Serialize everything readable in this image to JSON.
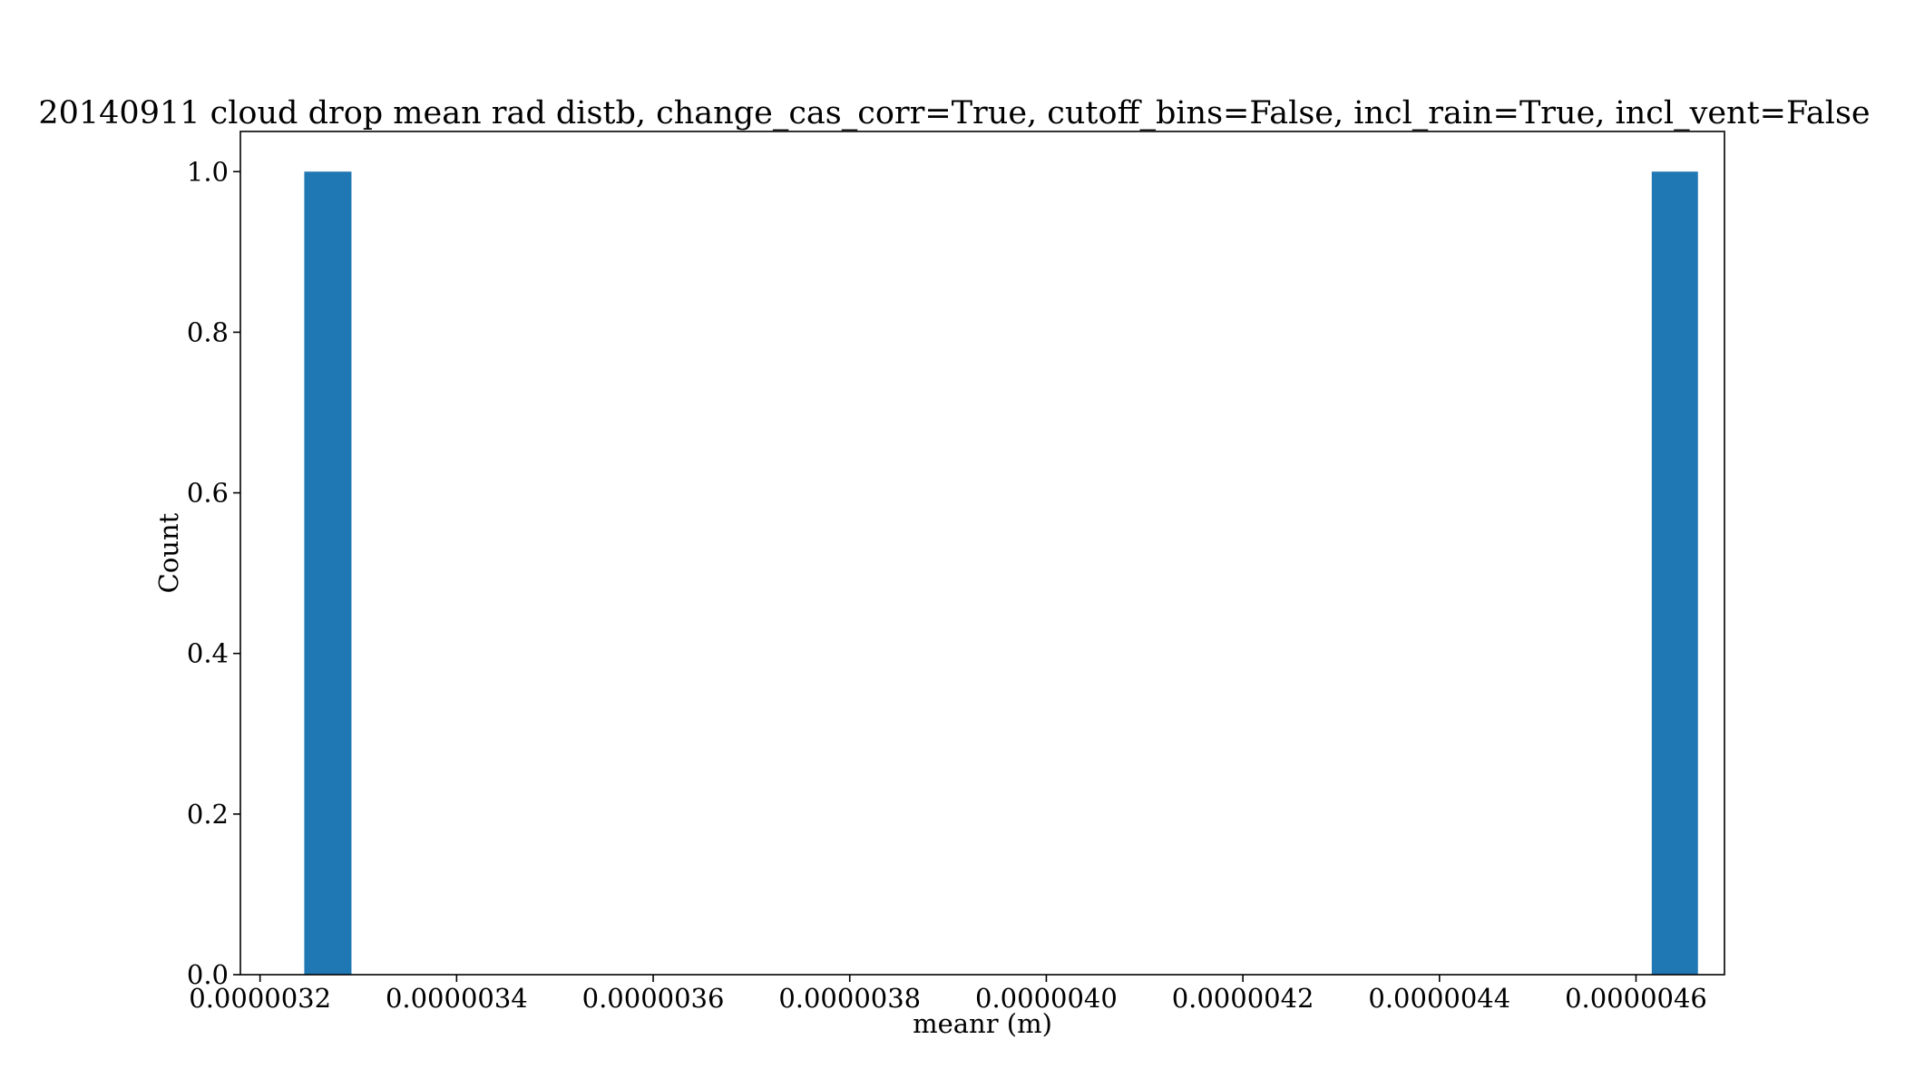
{
  "chart_data": {
    "type": "bar",
    "title": "20140911 cloud drop mean rad distb, change_cas_corr=True, cutoff_bins=False, incl_rain=True, incl_vent=False",
    "xlabel": "meanr (m)",
    "ylabel": "Count",
    "xlim": [
      3.18e-06,
      4.69e-06
    ],
    "ylim": [
      0,
      1.05
    ],
    "grid": false,
    "bar_color": "#1f77b4",
    "x_ticks": [
      {
        "value": 3.2e-06,
        "label": "0.0000032"
      },
      {
        "value": 3.4e-06,
        "label": "0.0000034"
      },
      {
        "value": 3.6e-06,
        "label": "0.0000036"
      },
      {
        "value": 3.8e-06,
        "label": "0.0000038"
      },
      {
        "value": 4e-06,
        "label": "0.0000040"
      },
      {
        "value": 4.2e-06,
        "label": "0.0000042"
      },
      {
        "value": 4.4e-06,
        "label": "0.0000044"
      },
      {
        "value": 4.6e-06,
        "label": "0.0000046"
      }
    ],
    "y_ticks": [
      {
        "value": 0.0,
        "label": "0.0"
      },
      {
        "value": 0.2,
        "label": "0.2"
      },
      {
        "value": 0.4,
        "label": "0.4"
      },
      {
        "value": 0.6,
        "label": "0.6"
      },
      {
        "value": 0.8,
        "label": "0.8"
      },
      {
        "value": 1.0,
        "label": "1.0"
      }
    ],
    "bins": [
      {
        "x0": 3.245e-06,
        "x1": 3.293e-06,
        "count": 1
      },
      {
        "x0": 4.616e-06,
        "x1": 4.663e-06,
        "count": 1
      }
    ]
  }
}
